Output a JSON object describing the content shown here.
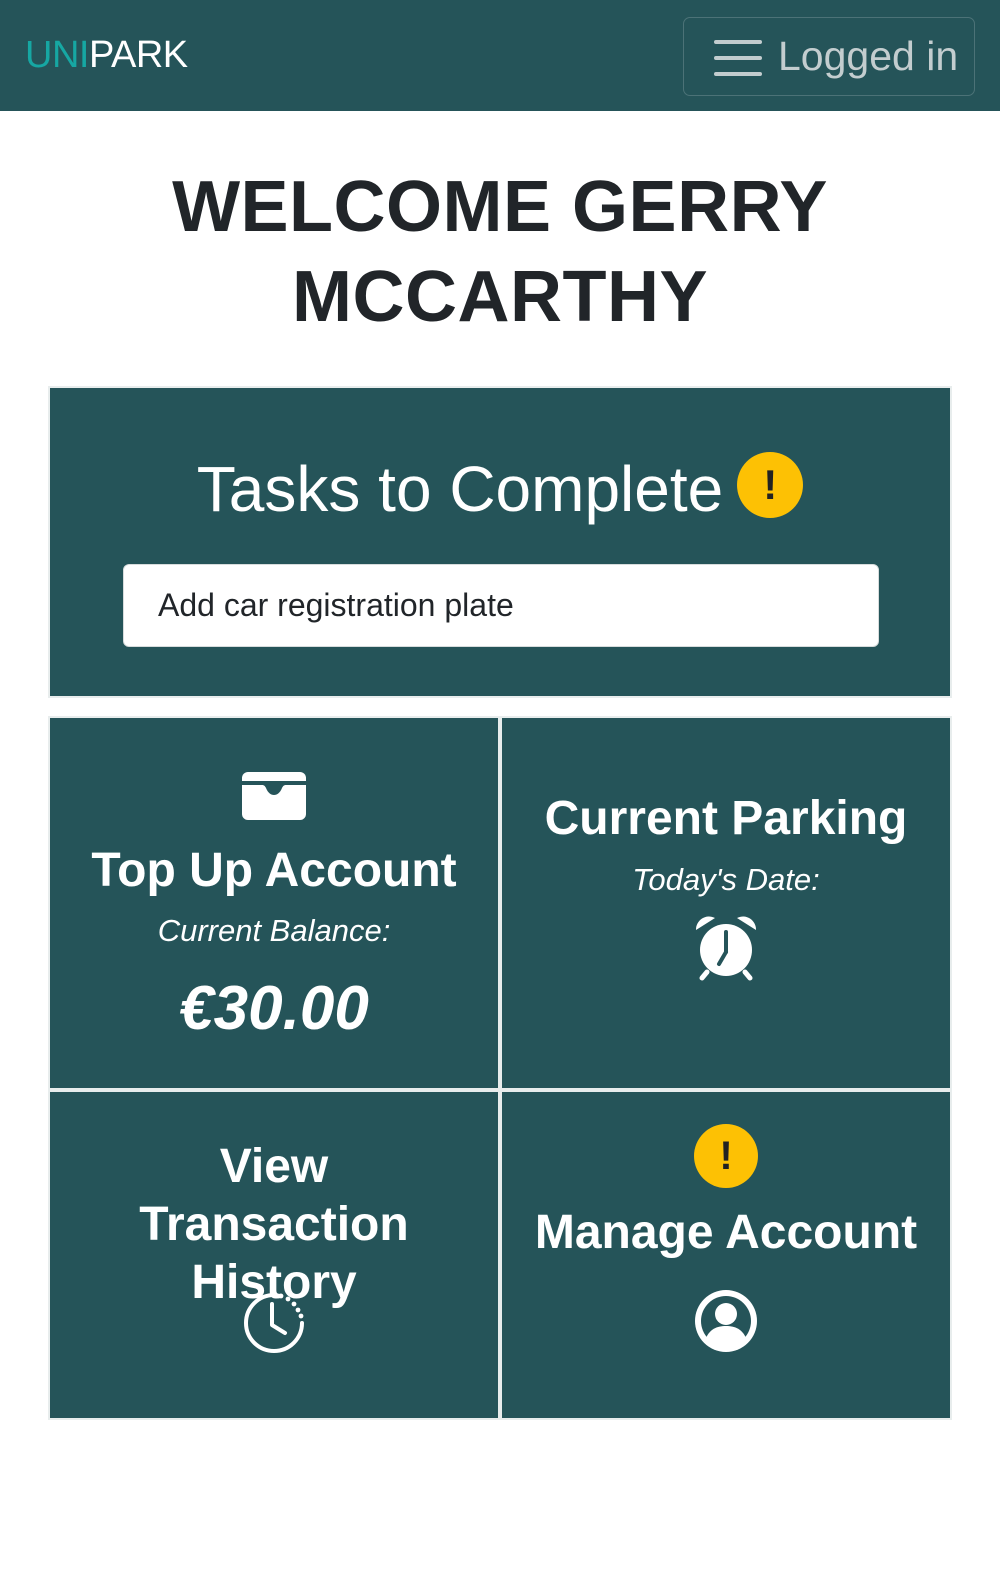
{
  "navbar": {
    "brand_prefix": "UNI",
    "brand_suffix": "PARK",
    "menu_label": "Logged in",
    "menu_icon": "hamburger-icon"
  },
  "welcome": {
    "heading": "WELCOME GERRY MCCARTHY"
  },
  "tasks": {
    "title": "Tasks to Complete",
    "badge": "!",
    "items": [
      {
        "label": "Add car registration plate"
      }
    ]
  },
  "tiles": {
    "topup": {
      "icon": "wallet-icon",
      "title": "Top Up Account",
      "subtitle": "Current Balance:",
      "balance": "€30.00"
    },
    "parking": {
      "title": "Current Parking",
      "subtitle": "Today's Date:",
      "icon": "alarm-clock-icon"
    },
    "history": {
      "title": "View Transaction History",
      "icon": "clock-history-icon"
    },
    "manage": {
      "badge": "!",
      "title": "Manage Account",
      "icon": "user-circle-icon"
    }
  },
  "colors": {
    "primary": "#255459",
    "brand_accent": "#16a7a3",
    "warning": "#fdc104",
    "heading_text": "#212529"
  }
}
